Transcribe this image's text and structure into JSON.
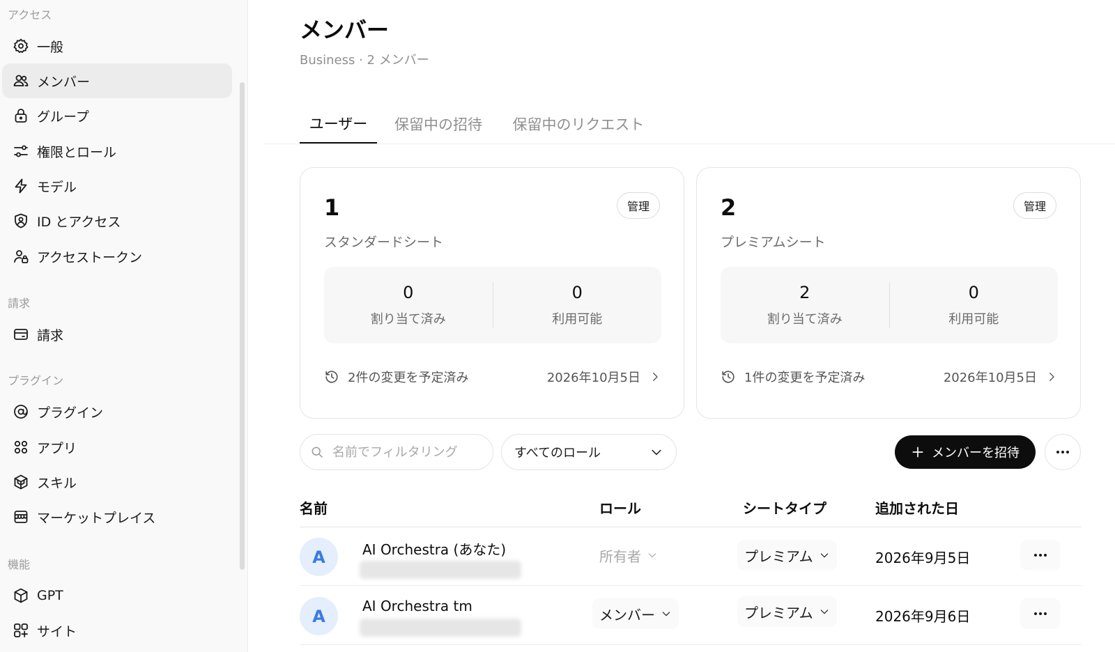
{
  "sidebar": {
    "sections": [
      {
        "title": "アクセス",
        "items": [
          {
            "label": "一般",
            "icon": "gear-icon"
          },
          {
            "label": "メンバー",
            "icon": "users-icon",
            "active": true
          },
          {
            "label": "グループ",
            "icon": "lock-icon"
          },
          {
            "label": "権限とロール",
            "icon": "sliders-icon"
          },
          {
            "label": "モデル",
            "icon": "bolt-icon"
          },
          {
            "label": "ID とアクセス",
            "icon": "shield-user-icon"
          },
          {
            "label": "アクセストークン",
            "icon": "user-lock-icon"
          }
        ]
      },
      {
        "title": "請求",
        "items": [
          {
            "label": "請求",
            "icon": "card-icon"
          }
        ]
      },
      {
        "title": "プラグイン",
        "items": [
          {
            "label": "プラグイン",
            "icon": "at-icon"
          },
          {
            "label": "アプリ",
            "icon": "apps-icon"
          },
          {
            "label": "スキル",
            "icon": "cube-stack-icon"
          },
          {
            "label": "マーケットプレイス",
            "icon": "store-icon"
          }
        ]
      },
      {
        "title": "機能",
        "items": [
          {
            "label": "GPT",
            "icon": "cube-icon"
          },
          {
            "label": "サイト",
            "icon": "site-icon"
          }
        ]
      }
    ]
  },
  "header": {
    "title": "メンバー",
    "subtitle": "Business · 2 メンバー"
  },
  "tabs": [
    {
      "label": "ユーザー",
      "active": true
    },
    {
      "label": "保留中の招待",
      "active": false
    },
    {
      "label": "保留中のリクエスト",
      "active": false
    }
  ],
  "cards": [
    {
      "count": "1",
      "label": "スタンダードシート",
      "manage_label": "管理",
      "assigned_value": "0",
      "assigned_label": "割り当て済み",
      "available_value": "0",
      "available_label": "利用可能",
      "scheduled_text": "2件の変更を予定済み",
      "scheduled_date": "2026年10月5日"
    },
    {
      "count": "2",
      "label": "プレミアムシート",
      "manage_label": "管理",
      "assigned_value": "2",
      "assigned_label": "割り当て済み",
      "available_value": "0",
      "available_label": "利用可能",
      "scheduled_text": "1件の変更を予定済み",
      "scheduled_date": "2026年10月5日"
    }
  ],
  "toolbar": {
    "search_placeholder": "名前でフィルタリング",
    "role_filter": "すべてのロール",
    "invite_label": "メンバーを招待"
  },
  "table": {
    "columns": [
      "名前",
      "ロール",
      "シートタイプ",
      "追加された日"
    ],
    "rows": [
      {
        "avatar": "A",
        "name": "AI Orchestra (あなた)",
        "role": "所有者",
        "role_editable": false,
        "seat": "プレミアム",
        "date": "2026年9月5日"
      },
      {
        "avatar": "A",
        "name": "AI Orchestra tm",
        "role": "メンバー",
        "role_editable": true,
        "seat": "プレミアム",
        "date": "2026年9月6日"
      }
    ]
  }
}
